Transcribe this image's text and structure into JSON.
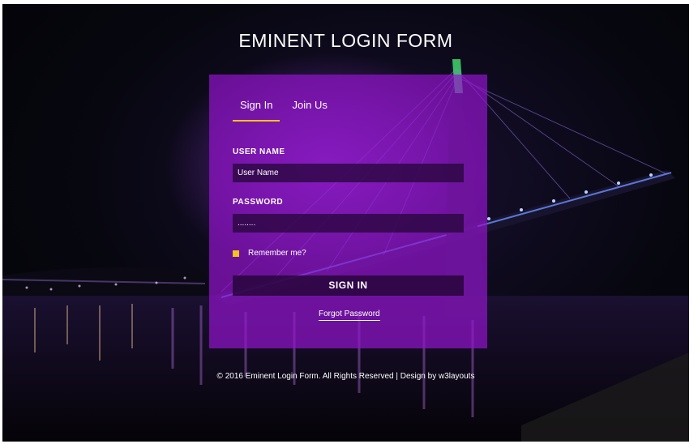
{
  "page": {
    "title": "EMINENT LOGIN FORM"
  },
  "tabs": [
    {
      "label": "Sign In",
      "active": true
    },
    {
      "label": "Join Us",
      "active": false
    }
  ],
  "form": {
    "username_label": "USER NAME",
    "username_value": "User Name",
    "password_label": "PASSWORD",
    "password_value": "........",
    "remember_label": "Remember me?",
    "remember_checked": true,
    "signin_label": "SIGN IN",
    "forgot_label": "Forgot Password"
  },
  "footer": {
    "text": "© 2016 Eminent Login Form. All Rights Reserved | Design by w3layouts"
  },
  "colors": {
    "panel": "#9314cd",
    "accent": "#f4c21a",
    "field_bg": "#28063c",
    "text": "#ffffff"
  }
}
